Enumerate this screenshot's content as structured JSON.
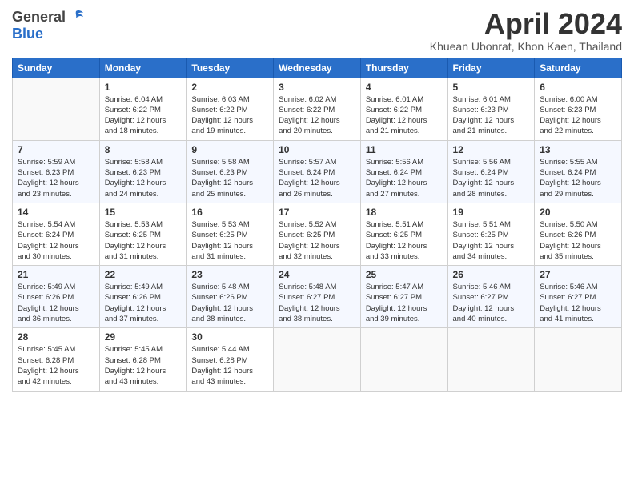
{
  "header": {
    "logo_general": "General",
    "logo_blue": "Blue",
    "month_title": "April 2024",
    "location": "Khuean Ubonrat, Khon Kaen, Thailand"
  },
  "days_of_week": [
    "Sunday",
    "Monday",
    "Tuesday",
    "Wednesday",
    "Thursday",
    "Friday",
    "Saturday"
  ],
  "weeks": [
    [
      {
        "day": "",
        "content": ""
      },
      {
        "day": "1",
        "content": "Sunrise: 6:04 AM\nSunset: 6:22 PM\nDaylight: 12 hours\nand 18 minutes."
      },
      {
        "day": "2",
        "content": "Sunrise: 6:03 AM\nSunset: 6:22 PM\nDaylight: 12 hours\nand 19 minutes."
      },
      {
        "day": "3",
        "content": "Sunrise: 6:02 AM\nSunset: 6:22 PM\nDaylight: 12 hours\nand 20 minutes."
      },
      {
        "day": "4",
        "content": "Sunrise: 6:01 AM\nSunset: 6:22 PM\nDaylight: 12 hours\nand 21 minutes."
      },
      {
        "day": "5",
        "content": "Sunrise: 6:01 AM\nSunset: 6:23 PM\nDaylight: 12 hours\nand 21 minutes."
      },
      {
        "day": "6",
        "content": "Sunrise: 6:00 AM\nSunset: 6:23 PM\nDaylight: 12 hours\nand 22 minutes."
      }
    ],
    [
      {
        "day": "7",
        "content": "Sunrise: 5:59 AM\nSunset: 6:23 PM\nDaylight: 12 hours\nand 23 minutes."
      },
      {
        "day": "8",
        "content": "Sunrise: 5:58 AM\nSunset: 6:23 PM\nDaylight: 12 hours\nand 24 minutes."
      },
      {
        "day": "9",
        "content": "Sunrise: 5:58 AM\nSunset: 6:23 PM\nDaylight: 12 hours\nand 25 minutes."
      },
      {
        "day": "10",
        "content": "Sunrise: 5:57 AM\nSunset: 6:24 PM\nDaylight: 12 hours\nand 26 minutes."
      },
      {
        "day": "11",
        "content": "Sunrise: 5:56 AM\nSunset: 6:24 PM\nDaylight: 12 hours\nand 27 minutes."
      },
      {
        "day": "12",
        "content": "Sunrise: 5:56 AM\nSunset: 6:24 PM\nDaylight: 12 hours\nand 28 minutes."
      },
      {
        "day": "13",
        "content": "Sunrise: 5:55 AM\nSunset: 6:24 PM\nDaylight: 12 hours\nand 29 minutes."
      }
    ],
    [
      {
        "day": "14",
        "content": "Sunrise: 5:54 AM\nSunset: 6:24 PM\nDaylight: 12 hours\nand 30 minutes."
      },
      {
        "day": "15",
        "content": "Sunrise: 5:53 AM\nSunset: 6:25 PM\nDaylight: 12 hours\nand 31 minutes."
      },
      {
        "day": "16",
        "content": "Sunrise: 5:53 AM\nSunset: 6:25 PM\nDaylight: 12 hours\nand 31 minutes."
      },
      {
        "day": "17",
        "content": "Sunrise: 5:52 AM\nSunset: 6:25 PM\nDaylight: 12 hours\nand 32 minutes."
      },
      {
        "day": "18",
        "content": "Sunrise: 5:51 AM\nSunset: 6:25 PM\nDaylight: 12 hours\nand 33 minutes."
      },
      {
        "day": "19",
        "content": "Sunrise: 5:51 AM\nSunset: 6:25 PM\nDaylight: 12 hours\nand 34 minutes."
      },
      {
        "day": "20",
        "content": "Sunrise: 5:50 AM\nSunset: 6:26 PM\nDaylight: 12 hours\nand 35 minutes."
      }
    ],
    [
      {
        "day": "21",
        "content": "Sunrise: 5:49 AM\nSunset: 6:26 PM\nDaylight: 12 hours\nand 36 minutes."
      },
      {
        "day": "22",
        "content": "Sunrise: 5:49 AM\nSunset: 6:26 PM\nDaylight: 12 hours\nand 37 minutes."
      },
      {
        "day": "23",
        "content": "Sunrise: 5:48 AM\nSunset: 6:26 PM\nDaylight: 12 hours\nand 38 minutes."
      },
      {
        "day": "24",
        "content": "Sunrise: 5:48 AM\nSunset: 6:27 PM\nDaylight: 12 hours\nand 38 minutes."
      },
      {
        "day": "25",
        "content": "Sunrise: 5:47 AM\nSunset: 6:27 PM\nDaylight: 12 hours\nand 39 minutes."
      },
      {
        "day": "26",
        "content": "Sunrise: 5:46 AM\nSunset: 6:27 PM\nDaylight: 12 hours\nand 40 minutes."
      },
      {
        "day": "27",
        "content": "Sunrise: 5:46 AM\nSunset: 6:27 PM\nDaylight: 12 hours\nand 41 minutes."
      }
    ],
    [
      {
        "day": "28",
        "content": "Sunrise: 5:45 AM\nSunset: 6:28 PM\nDaylight: 12 hours\nand 42 minutes."
      },
      {
        "day": "29",
        "content": "Sunrise: 5:45 AM\nSunset: 6:28 PM\nDaylight: 12 hours\nand 43 minutes."
      },
      {
        "day": "30",
        "content": "Sunrise: 5:44 AM\nSunset: 6:28 PM\nDaylight: 12 hours\nand 43 minutes."
      },
      {
        "day": "",
        "content": ""
      },
      {
        "day": "",
        "content": ""
      },
      {
        "day": "",
        "content": ""
      },
      {
        "day": "",
        "content": ""
      }
    ]
  ]
}
